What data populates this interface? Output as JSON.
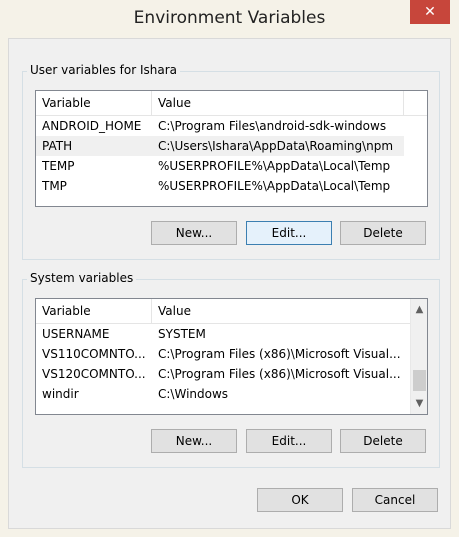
{
  "window": {
    "title": "Environment Variables",
    "close_glyph": "✕"
  },
  "user_vars": {
    "group_label": "User variables for Ishara",
    "columns": [
      "Variable",
      "Value"
    ],
    "rows": [
      {
        "variable": "ANDROID_HOME",
        "value": "C:\\Program Files\\android-sdk-windows"
      },
      {
        "variable": "PATH",
        "value": "C:\\Users\\Ishara\\AppData\\Roaming\\npm"
      },
      {
        "variable": "TEMP",
        "value": "%USERPROFILE%\\AppData\\Local\\Temp"
      },
      {
        "variable": "TMP",
        "value": "%USERPROFILE%\\AppData\\Local\\Temp"
      }
    ],
    "selected_row": 1,
    "buttons": {
      "new": "New...",
      "edit": "Edit...",
      "delete": "Delete"
    }
  },
  "system_vars": {
    "group_label": "System variables",
    "columns": [
      "Variable",
      "Value"
    ],
    "rows": [
      {
        "variable": "USERNAME",
        "value": "SYSTEM"
      },
      {
        "variable": "VS110COMNTO...",
        "value": "C:\\Program Files (x86)\\Microsoft Visual..."
      },
      {
        "variable": "VS120COMNTO...",
        "value": "C:\\Program Files (x86)\\Microsoft Visual..."
      },
      {
        "variable": "windir",
        "value": "C:\\Windows"
      }
    ],
    "scroll_up_glyph": "▲",
    "scroll_down_glyph": "▼",
    "buttons": {
      "new": "New...",
      "edit": "Edit...",
      "delete": "Delete"
    }
  },
  "dialog_buttons": {
    "ok": "OK",
    "cancel": "Cancel"
  },
  "colors": {
    "close": "#c7463b",
    "focus_border": "#3c7fb1"
  }
}
